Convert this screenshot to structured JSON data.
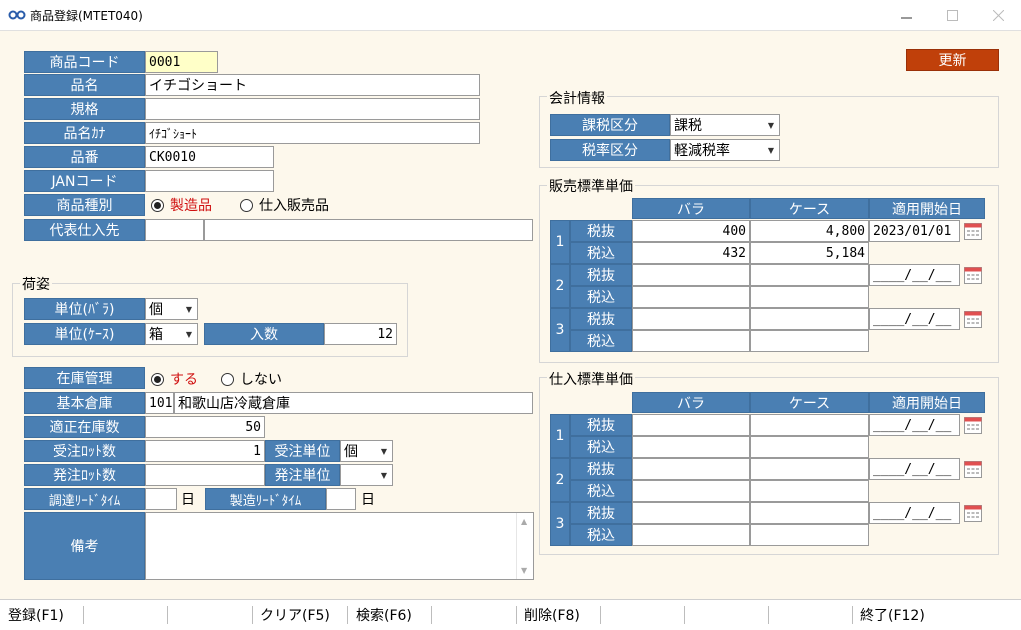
{
  "window": {
    "title": "商品登録(MTET040)"
  },
  "header": {
    "update_label": "更新"
  },
  "product": {
    "code_label": "商品コード",
    "code_value": "0001",
    "name_label": "品名",
    "name_value": "イチゴショート",
    "spec_label": "規格",
    "spec_value": "",
    "kana_label": "品名ｶﾅ",
    "kana_value": "ｲﾁｺﾞｼｮｰﾄ",
    "number_label": "品番",
    "number_value": "CK0010",
    "jan_label": "JANコード",
    "jan_value": "",
    "type_label": "商品種別",
    "type_options": [
      "製造品",
      "仕入販売品"
    ],
    "type_selected": "製造品",
    "supplier_label": "代表仕入先",
    "supplier_code": "",
    "supplier_name": ""
  },
  "packing": {
    "title": "荷姿",
    "unit_bara_label": "単位(ﾊﾞﾗ)",
    "unit_bara_value": "個",
    "unit_case_label": "単位(ｹｰｽ)",
    "unit_case_value": "箱",
    "qty_label": "入数",
    "qty_value": "12"
  },
  "stock": {
    "manage_label": "在庫管理",
    "manage_options": [
      "する",
      "しない"
    ],
    "manage_selected": "する",
    "warehouse_label": "基本倉庫",
    "warehouse_code": "101",
    "warehouse_name": "和歌山店冷蔵倉庫",
    "proper_label": "適正在庫数",
    "proper_value": "50",
    "order_lot_label": "受注ﾛｯﾄ数",
    "order_lot_value": "1",
    "order_unit_label": "受注単位",
    "order_unit_value": "個",
    "purchase_lot_label": "発注ﾛｯﾄ数",
    "purchase_lot_value": "",
    "purchase_unit_label": "発注単位",
    "purchase_unit_value": "",
    "procure_lead_label": "調達ﾘｰﾄﾞﾀｲﾑ",
    "procure_lead_value": "",
    "day_unit": "日",
    "mfg_lead_label": "製造ﾘｰﾄﾞﾀｲﾑ",
    "mfg_lead_value": "",
    "memo_label": "備考",
    "memo_value": ""
  },
  "accounting": {
    "title": "会計情報",
    "tax_class_label": "課税区分",
    "tax_class_value": "課税",
    "tax_rate_label": "税率区分",
    "tax_rate_value": "軽減税率"
  },
  "sales_price": {
    "title": "販売標準単価",
    "col_bara": "バラ",
    "col_case": "ケース",
    "col_date": "適用開始日",
    "rows": [
      {
        "no": "1",
        "excl_label": "税抜",
        "incl_label": "税込",
        "bara_excl": "400",
        "case_excl": "4,800",
        "bara_incl": "432",
        "case_incl": "5,184",
        "date": "2023/01/01"
      },
      {
        "no": "2",
        "excl_label": "税抜",
        "incl_label": "税込",
        "bara_excl": "",
        "case_excl": "",
        "bara_incl": "",
        "case_incl": "",
        "date": "____/__/__"
      },
      {
        "no": "3",
        "excl_label": "税抜",
        "incl_label": "税込",
        "bara_excl": "",
        "case_excl": "",
        "bara_incl": "",
        "case_incl": "",
        "date": "____/__/__"
      }
    ]
  },
  "purchase_price": {
    "title": "仕入標準単価",
    "col_bara": "バラ",
    "col_case": "ケース",
    "col_date": "適用開始日",
    "rows": [
      {
        "no": "1",
        "excl_label": "税抜",
        "incl_label": "税込",
        "bara_excl": "",
        "case_excl": "",
        "bara_incl": "",
        "case_incl": "",
        "date": "____/__/__"
      },
      {
        "no": "2",
        "excl_label": "税抜",
        "incl_label": "税込",
        "bara_excl": "",
        "case_excl": "",
        "bara_incl": "",
        "case_incl": "",
        "date": "____/__/__"
      },
      {
        "no": "3",
        "excl_label": "税抜",
        "incl_label": "税込",
        "bara_excl": "",
        "case_excl": "",
        "bara_incl": "",
        "case_incl": "",
        "date": "____/__/__"
      }
    ]
  },
  "footer": {
    "register": "登録(F1)",
    "clear": "クリア(F5)",
    "search": "検索(F6)",
    "delete": "削除(F8)",
    "exit": "終了(F12)"
  },
  "colors": {
    "label_bg": "#4a7fb3",
    "accent": "#c0400a",
    "client_bg": "#fdf8ec",
    "field_focus": "#ffffc8"
  }
}
